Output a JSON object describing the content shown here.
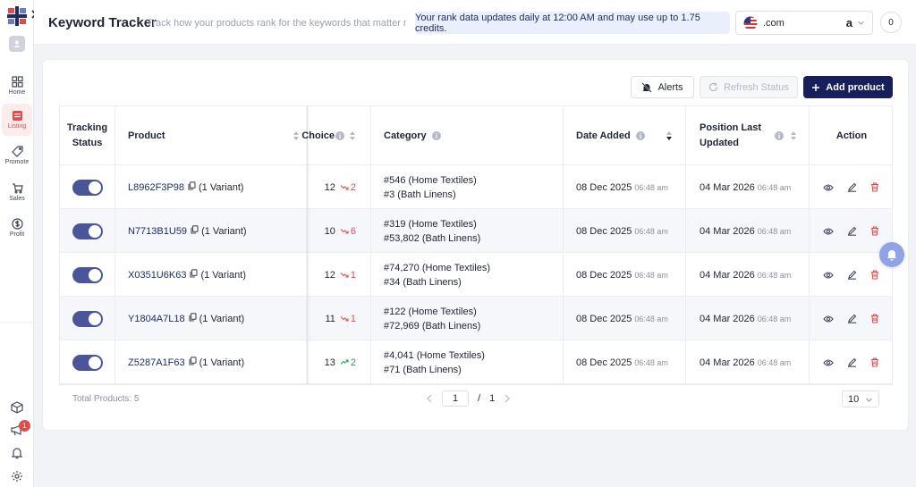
{
  "sidebar": {
    "items": [
      {
        "label": "Home",
        "icon": "grid-icon"
      },
      {
        "label": "Listing",
        "icon": "listing-icon"
      },
      {
        "label": "Promote",
        "icon": "tag-icon"
      },
      {
        "label": "Sales",
        "icon": "cart-icon"
      },
      {
        "label": "Profit",
        "icon": "dollar-icon"
      }
    ],
    "notification_count": "1"
  },
  "header": {
    "title": "Keyword Tracker",
    "subtitle": "Track how your products rank for the keywords that matter mo",
    "notice": "Your rank data updates daily at 12:00 AM and may use up to 1.75 credits.",
    "marketplace": ".com",
    "marketplace_logo": "a",
    "credits": "0"
  },
  "toolbar": {
    "alerts_label": "Alerts",
    "refresh_label": "Refresh Status",
    "add_label": "Add product"
  },
  "table": {
    "headers": {
      "tracking_status": "Tracking Status",
      "product": "Product",
      "choice": "Choice",
      "category": "Category",
      "date_added": "Date Added",
      "position_last_updated": "Position Last Updated",
      "action": "Action"
    },
    "rows": [
      {
        "asin": "L8962F3P98",
        "variant": "(1 Variant)",
        "rank": "12",
        "delta": "2",
        "trend": "down",
        "cat1": "#546 (Home Textiles)",
        "cat2": "#3 (Bath Linens)",
        "date": "08 Dec 2025",
        "date_time": "06:48 am",
        "updated": "04 Mar 2026",
        "updated_time": "06:48 am"
      },
      {
        "asin": "N7713B1U59",
        "variant": "(1 Variant)",
        "rank": "10",
        "delta": "6",
        "trend": "down",
        "cat1": "#319 (Home Textiles)",
        "cat2": "#53,802 (Bath Linens)",
        "date": "08 Dec 2025",
        "date_time": "06:48 am",
        "updated": "04 Mar 2026",
        "updated_time": "06:48 am"
      },
      {
        "asin": "X0351U6K63",
        "variant": "(1 Variant)",
        "rank": "12",
        "delta": "1",
        "trend": "down",
        "cat1": "#74,270 (Home Textiles)",
        "cat2": "#34 (Bath Linens)",
        "date": "08 Dec 2025",
        "date_time": "06:48 am",
        "updated": "04 Mar 2026",
        "updated_time": "06:48 am"
      },
      {
        "asin": "Y1804A7L18",
        "variant": "(1 Variant)",
        "rank": "11",
        "delta": "1",
        "trend": "down",
        "cat1": "#122 (Home Textiles)",
        "cat2": "#72,969 (Bath Linens)",
        "date": "08 Dec 2025",
        "date_time": "06:48 am",
        "updated": "04 Mar 2026",
        "updated_time": "06:48 am"
      },
      {
        "asin": "Z5287A1F63",
        "variant": "(1 Variant)",
        "rank": "13",
        "delta": "2",
        "trend": "up",
        "cat1": "#4,041 (Home Textiles)",
        "cat2": "#71 (Bath Linens)",
        "date": "08 Dec 2025",
        "date_time": "06:48 am",
        "updated": "04 Mar 2026",
        "updated_time": "06:48 am"
      }
    ]
  },
  "footer": {
    "total": "Total Products: 5",
    "page_current": "1",
    "page_sep": "/",
    "page_total": "1",
    "per_page": "10"
  },
  "colors": {
    "accent": "#17205a",
    "toggle": "#4a5699",
    "down": "#e24b4b",
    "up": "#2e9b4a"
  }
}
